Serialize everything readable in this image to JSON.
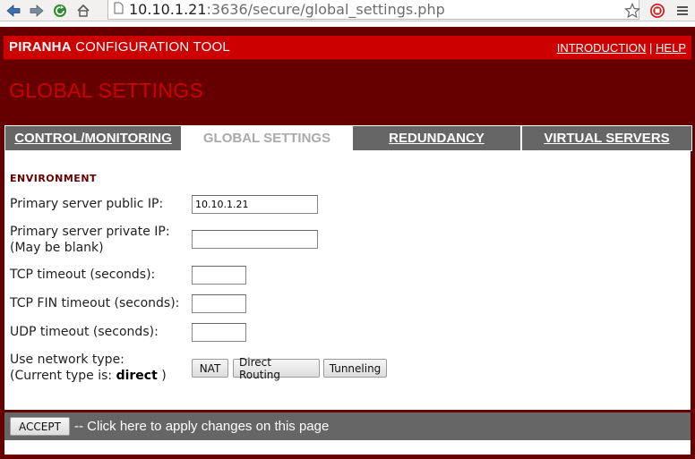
{
  "browser": {
    "url_host": "10.10.1.21",
    "url_rest": ":3636/secure/global_settings.php",
    "icons": [
      "back-arrow-icon",
      "forward-arrow-icon",
      "reload-icon",
      "home-icon",
      "page-icon",
      "star-icon",
      "stop-icon",
      "menu-icon"
    ]
  },
  "header": {
    "brand_bold": "PIRANHA",
    "brand_rest": " CONFIGURATION TOOL",
    "link_intro": "INTRODUCTION",
    "separator": "|",
    "link_help": "HELP"
  },
  "page_title": "GLOBAL SETTINGS",
  "tabs": [
    {
      "label": "CONTROL/MONITORING"
    },
    {
      "label": "GLOBAL SETTINGS"
    },
    {
      "label": "REDUNDANCY"
    },
    {
      "label": "VIRTUAL SERVERS"
    }
  ],
  "active_tab": "GLOBAL SETTINGS",
  "environment": {
    "section_label": "ENVIRONMENT",
    "primary_public_ip": {
      "label": "Primary server public IP:",
      "value": "10.10.1.21"
    },
    "primary_private_ip": {
      "label_line1": "Primary server private IP:",
      "label_line2": "(May be blank)",
      "value": ""
    },
    "tcp_timeout": {
      "label": "TCP timeout (seconds):",
      "value": ""
    },
    "tcp_fin_timeout": {
      "label": "TCP FIN timeout (seconds):",
      "value": ""
    },
    "udp_timeout": {
      "label": "UDP timeout (seconds):",
      "value": ""
    },
    "network_type": {
      "label_line1": "Use network type:",
      "label_line2_prefix": "(Current type is: ",
      "current": "direct",
      "label_line2_suffix": " )",
      "buttons": [
        "NAT",
        "Direct Routing",
        "Tunneling"
      ]
    }
  },
  "footer": {
    "accept_label": "ACCEPT",
    "apply_text": "-- Click here to apply changes on this page"
  },
  "colors": {
    "frame": "#660000",
    "accent": "#cc0000",
    "tab_bg": "#666666"
  }
}
